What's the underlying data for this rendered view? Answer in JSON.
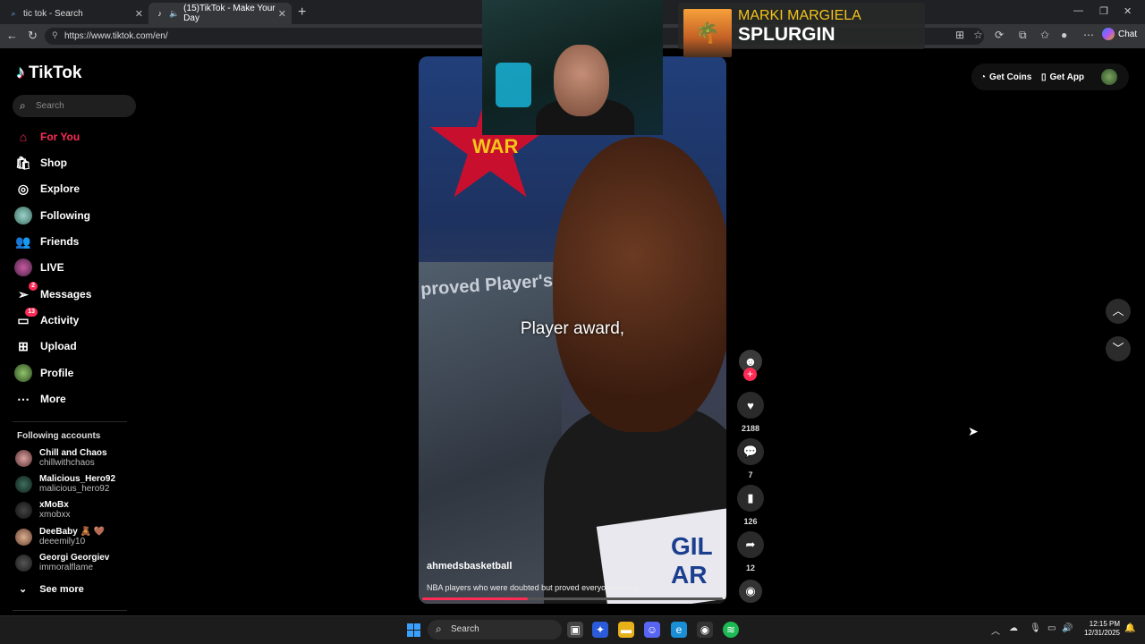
{
  "browser": {
    "tabs": [
      {
        "title": "tic tok - Search"
      },
      {
        "title": "(15)TikTok - Make Your Day"
      }
    ],
    "url": "https://www.tiktok.com/en/",
    "chat_label": "Chat"
  },
  "sidebar": {
    "logo": "TikTok",
    "search_placeholder": "Search",
    "items": [
      {
        "label": "For You",
        "icon": "home-icon"
      },
      {
        "label": "Shop",
        "icon": "shop-icon"
      },
      {
        "label": "Explore",
        "icon": "compass-icon"
      },
      {
        "label": "Following",
        "icon": "avatar-icon"
      },
      {
        "label": "Friends",
        "icon": "friends-icon"
      },
      {
        "label": "LIVE",
        "icon": "live-icon"
      },
      {
        "label": "Messages",
        "icon": "send-icon",
        "badge": "2"
      },
      {
        "label": "Activity",
        "icon": "inbox-icon",
        "badge": "13"
      },
      {
        "label": "Upload",
        "icon": "plus-square-icon"
      },
      {
        "label": "Profile",
        "icon": "avatar-icon"
      },
      {
        "label": "More",
        "icon": "more-icon"
      }
    ],
    "following_header": "Following accounts",
    "accounts": [
      {
        "name": "Chill and Chaos",
        "handle": "chillwithchaos"
      },
      {
        "name": "Malicious_Hero92",
        "handle": "malicious_hero92"
      },
      {
        "name": "xMoBx",
        "handle": "xmobxx"
      },
      {
        "name": "DeeBaby 🧸 🤎",
        "handle": "deeemily10"
      },
      {
        "name": "Georgi Georgiev",
        "handle": "immoralflame"
      }
    ],
    "see_more": "See more"
  },
  "video": {
    "caption": "Player award,",
    "author": "ahmedsbasketball",
    "description": "NBA players who were doubted but proved everyone wrong",
    "progress": 0.35,
    "trophy_text": "proved Player's",
    "logo_text": "WAR",
    "card_text": "GIL\nAR"
  },
  "actions": {
    "likes": "2188",
    "comments": "7",
    "saves": "126",
    "shares": "12"
  },
  "top_right": {
    "get_coins": "Get Coins",
    "get_app": "Get App"
  },
  "now_playing": {
    "artist": "MARKI MARGIELA",
    "title": "SPLURGIN"
  },
  "taskbar": {
    "search_label": "Search",
    "time": "12:15 PM",
    "date": "12/31/2025"
  }
}
